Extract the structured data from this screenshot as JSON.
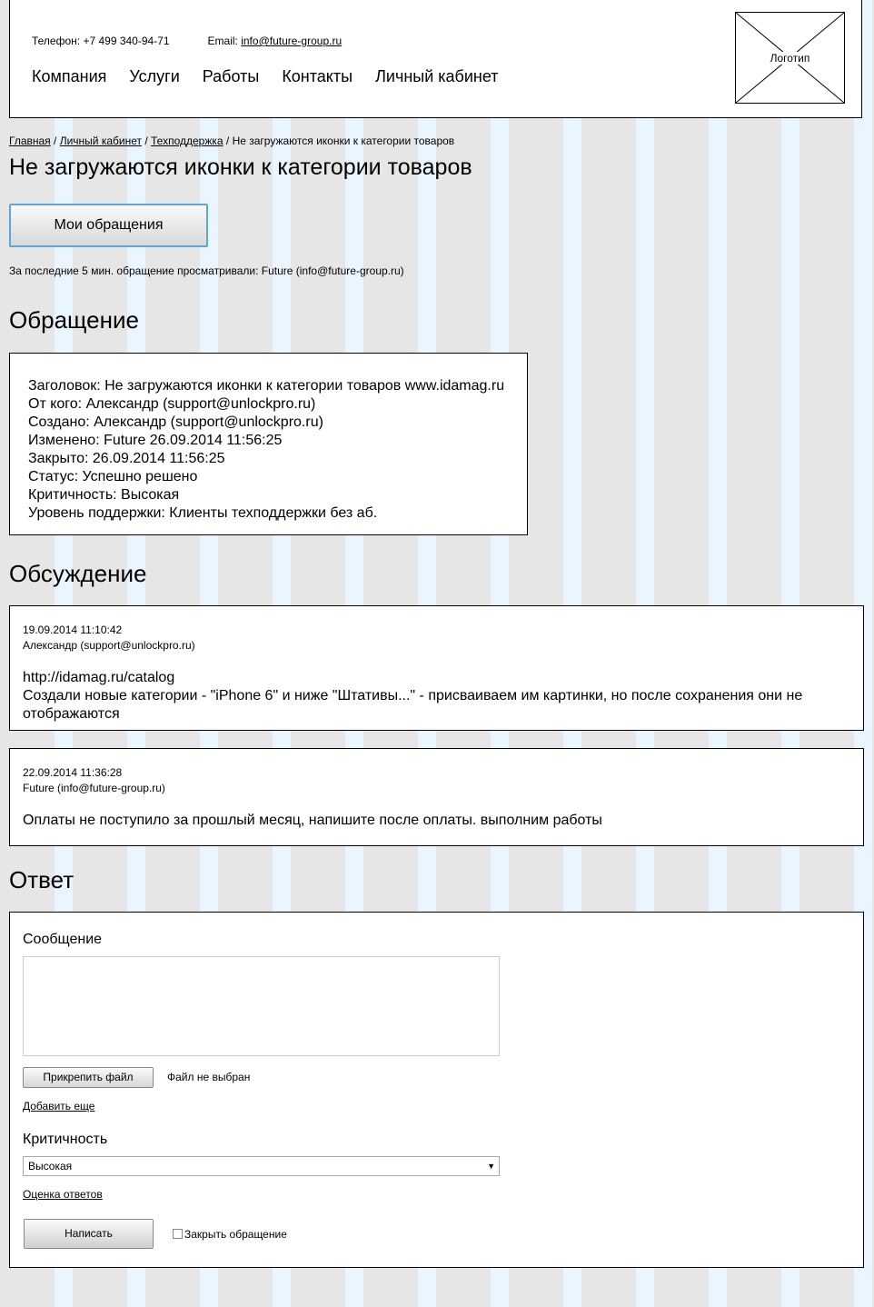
{
  "header": {
    "phone_label": "Телефон: +7 499 340-94-71",
    "email_prefix": "Email: ",
    "email": "info@future-group.ru",
    "nav": [
      "Компания",
      "Услуги",
      "Работы",
      "Контакты",
      "Личный кабинет"
    ],
    "logo_label": "Логотип"
  },
  "breadcrumb": {
    "items": [
      "Главная",
      "Личный кабинет",
      "Техподдержка"
    ],
    "separator": " / ",
    "current": "Не загружаются иконки к категории товаров"
  },
  "page_title": "Не загружаются иконки к категории товаров",
  "my_tickets_button": "Мои обращения",
  "viewers_text": "За последние 5 мин. обращение просматривали: Future (info@future-group.ru)",
  "ticket": {
    "heading": "Обращение",
    "lines": [
      "Заголовок: Не загружаются иконки к категории товаров www.idamag.ru",
      "От кого: Александр (support@unlockpro.ru)",
      "Создано: Александр (support@unlockpro.ru)",
      "Изменено: Future 26.09.2014 11:56:25",
      "Закрыто: 26.09.2014 11:56:25",
      "Статус: Успешно решено",
      "Критичность: Высокая",
      "Уровень поддержки: Клиенты техподдержки без аб."
    ]
  },
  "discussion": {
    "heading": "Обсуждение",
    "messages": [
      {
        "date": "19.09.2014 11:10:42",
        "author": "Александр (support@unlockpro.ru)",
        "body_lines": [
          "http://idamag.ru/catalog",
          "Создали новые категории - \"iPhone 6\" и ниже \"Штативы...\" - присваиваем им картинки, но после сохранения они не отображаются"
        ]
      },
      {
        "date": "22.09.2014 11:36:28",
        "author": "Future (info@future-group.ru)",
        "body_lines": [
          "Оплаты не поступило за прошлый месяц, напишите после оплаты. выполним работы"
        ]
      }
    ]
  },
  "reply": {
    "heading": "Ответ",
    "message_label": "Сообщение",
    "attach_button": "Прикрепить файл",
    "file_status": "Файл не выбран",
    "add_more": "Добавить еще",
    "criticality_label": "Критичность",
    "criticality_value": "Высокая",
    "rating_link": "Оценка ответов",
    "submit_button": "Написать",
    "close_ticket_label": "Закрыть обращение",
    "close_ticket_checked": false
  }
}
